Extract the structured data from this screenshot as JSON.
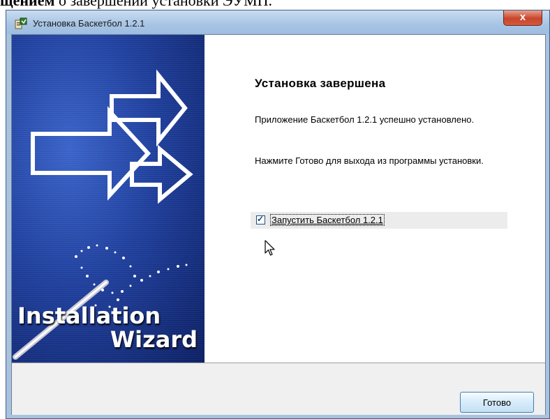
{
  "document": {
    "bold_text": "щением",
    "rest_text": " о завершении установки ЭУМП."
  },
  "window": {
    "title": "Установка Баскетбол 1.2.1",
    "close_glyph": "x"
  },
  "banner": {
    "line1": "Installation",
    "line2": "Wizard",
    "colors": {
      "dark": "#0c1f63",
      "mid": "#1f3f9c",
      "light": "#3a63c9"
    }
  },
  "content": {
    "heading": "Установка завершена",
    "message1": "Приложение Баскетбол 1.2.1 успешно установлено.",
    "message2": "Нажмите Готово для выхода из программы установки.",
    "launch_checkbox": {
      "label": "Запустить Баскетбол 1.2.1",
      "checked": true,
      "glyph": "✓"
    }
  },
  "footer": {
    "finish_label": "Готово"
  },
  "icons": [
    "installer-icon",
    "arrow-icon",
    "magic-wand-icon",
    "mouse-cursor-icon"
  ]
}
